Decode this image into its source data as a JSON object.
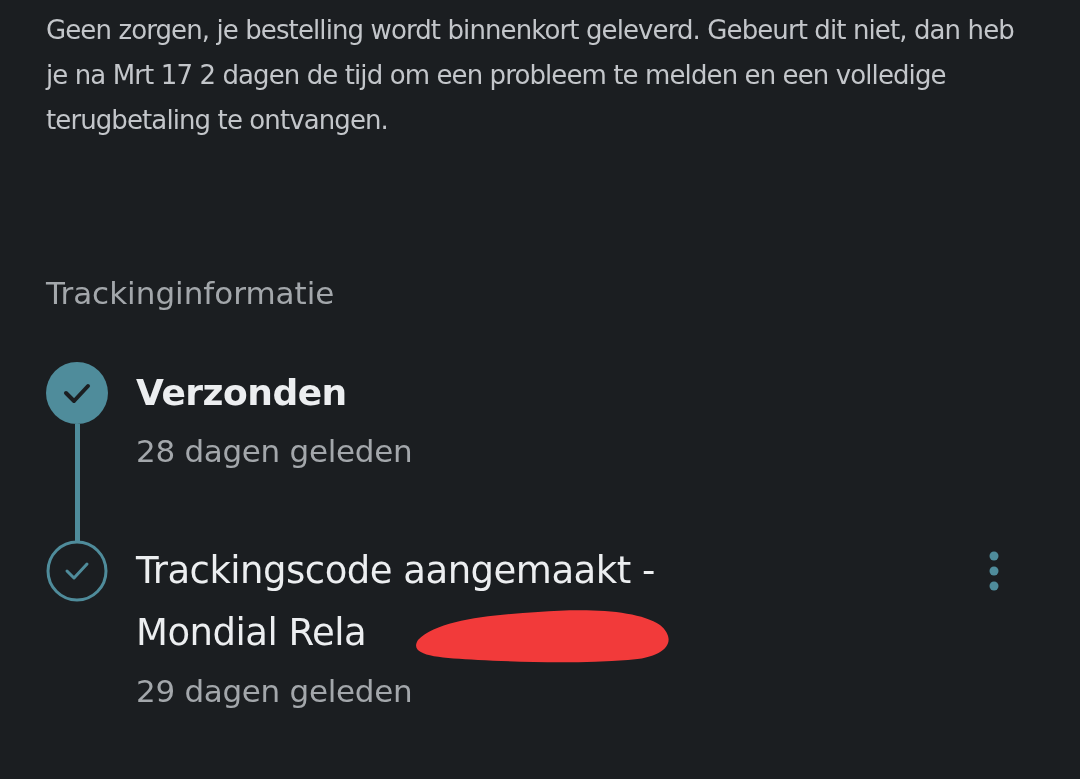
{
  "notice": "Geen zorgen, je bestelling wordt binnenkort geleverd. Gebeurt dit niet, dan heb je na Mrt 17 2 dagen de tijd om een probleem te melden en een volledige terugbetaling te ontvangen.",
  "tracking": {
    "heading": "Trackinginformatie",
    "events": [
      {
        "title": "Verzonden",
        "time": "28 dagen geleden",
        "current": true,
        "has_menu": false,
        "redacted": false
      },
      {
        "title": "Trackingscode aangemaakt - Mondial Rela",
        "time": "29 dagen geleden",
        "current": false,
        "has_menu": true,
        "redacted": true
      }
    ]
  }
}
